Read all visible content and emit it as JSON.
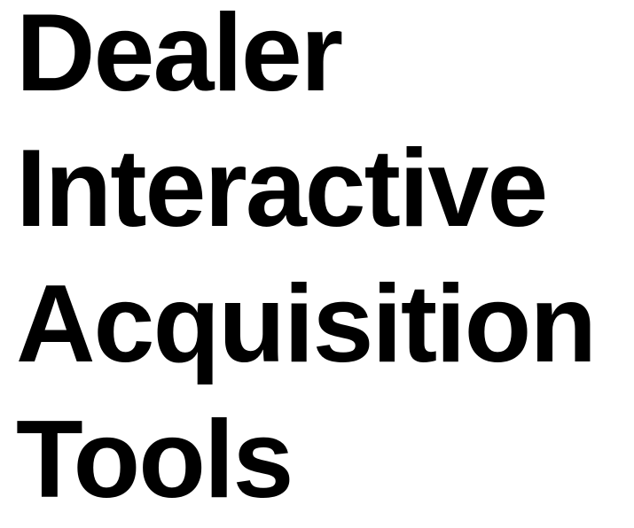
{
  "headline": {
    "lines": [
      "Dealer",
      "Interactive",
      "Acquisition",
      "Tools"
    ]
  }
}
